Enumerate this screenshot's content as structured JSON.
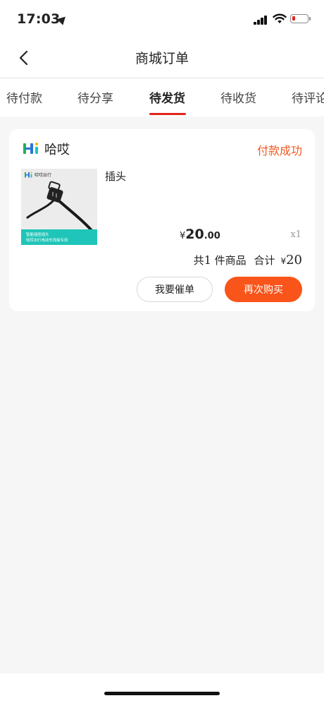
{
  "status_bar": {
    "time": "17:03",
    "battery_color": "#e0281e"
  },
  "navbar": {
    "title": "商城订单",
    "back_icon": "chevron-left-icon"
  },
  "tabs": [
    {
      "label": "待付款",
      "active": false
    },
    {
      "label": "待分享",
      "active": false
    },
    {
      "label": "待发货",
      "active": true
    },
    {
      "label": "待收货",
      "active": false
    },
    {
      "label": "待评论",
      "active": false
    }
  ],
  "order": {
    "shop_name": "哈哎",
    "status": "付款成功",
    "product": {
      "name": "插头",
      "image_brand": "哈哎出行",
      "image_caption_1": "智能插座插头",
      "image_caption_2": "哈哎出行电动车改装专用",
      "price_symbol": "¥",
      "price_int": "20",
      "price_dec": ".00",
      "quantity": "x1"
    },
    "summary": {
      "count_prefix": "共",
      "count": "1",
      "count_suffix": " 件商品",
      "total_label": "合计",
      "currency": "¥",
      "total": "20"
    },
    "buttons": {
      "urge": "我要催单",
      "rebuy": "再次购买"
    }
  },
  "colors": {
    "accent": "#f9541a",
    "tab_underline": "#e2231a",
    "status_text": "#f15a22",
    "thumb_strip": "#1fc5b8"
  }
}
